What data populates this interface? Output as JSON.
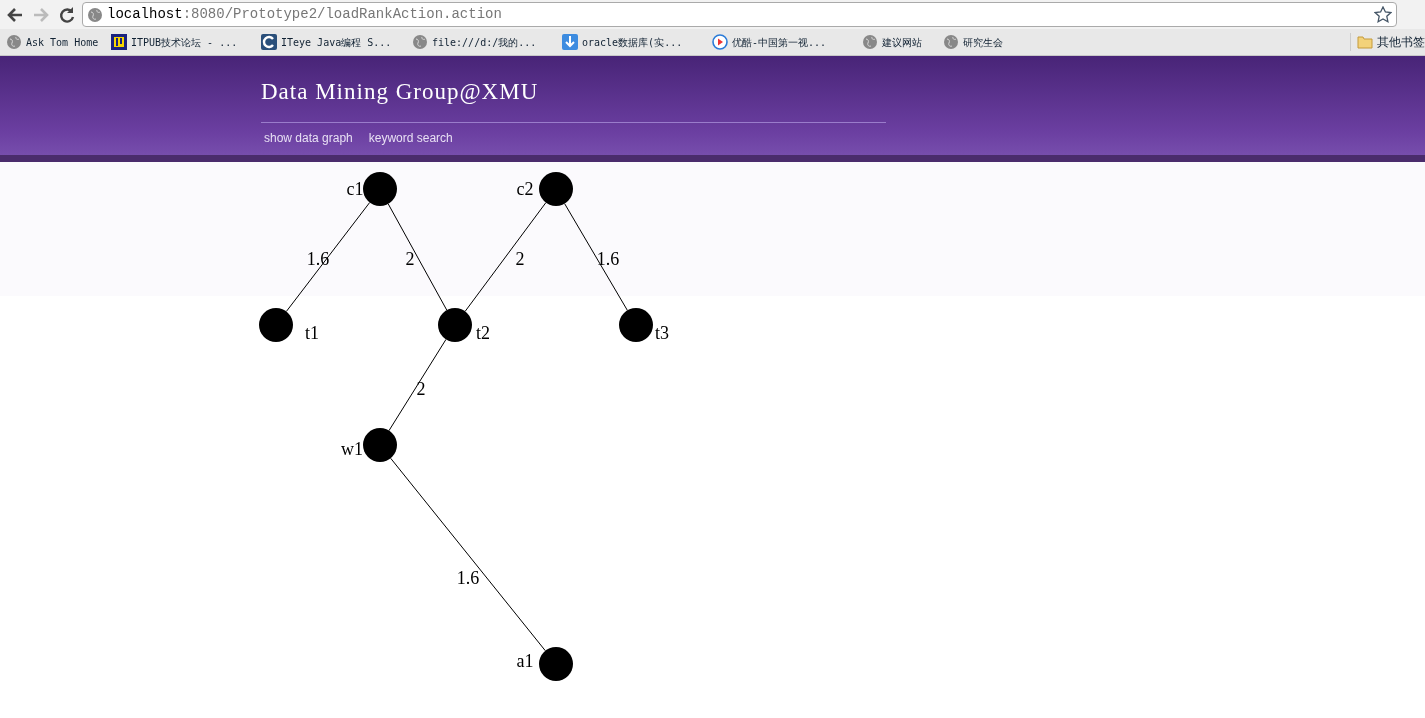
{
  "browser": {
    "address": {
      "host": "localhost",
      "rest": ":8080/Prototype2/loadRankAction.action"
    },
    "bookmarks": [
      {
        "label": "Ask Tom Home",
        "kind": "globe"
      },
      {
        "label": "ITPUB技术论坛 - ...",
        "kind": "itpub"
      },
      {
        "label": "ITeye Java编程 S...",
        "kind": "iteye"
      },
      {
        "label": "file:///d:/我的...",
        "kind": "globe"
      },
      {
        "label": "oracle数据库(实...",
        "kind": "download"
      },
      {
        "label": "优酷-中国第一视...",
        "kind": "play"
      },
      {
        "label": "建议网站",
        "kind": "globe"
      },
      {
        "label": "研究生会",
        "kind": "globe"
      }
    ],
    "other_bookmarks": "其他书签"
  },
  "header": {
    "title": "Data Mining Group@XMU",
    "nav": [
      "show data graph",
      "keyword search"
    ]
  },
  "graph": {
    "nodes": [
      {
        "label": "c1"
      },
      {
        "label": "c2"
      },
      {
        "label": "t1"
      },
      {
        "label": "t2"
      },
      {
        "label": "t3"
      },
      {
        "label": "w1"
      },
      {
        "label": "a1"
      }
    ],
    "edges": [
      {
        "weight": "1.6"
      },
      {
        "weight": "2"
      },
      {
        "weight": "2"
      },
      {
        "weight": "1.6"
      },
      {
        "weight": "2"
      },
      {
        "weight": "1.6"
      }
    ]
  }
}
